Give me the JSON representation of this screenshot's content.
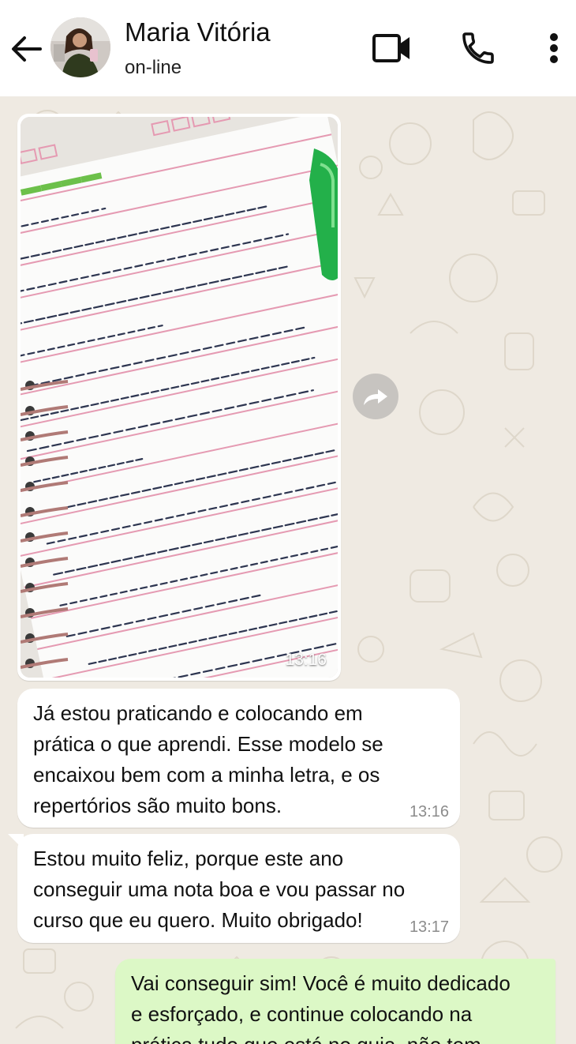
{
  "header": {
    "contact_name": "Maria Vitória",
    "contact_status": "on-line",
    "back_icon": "arrow-left-icon",
    "video_icon": "video-camera-icon",
    "call_icon": "phone-icon",
    "menu_icon": "more-vertical-icon"
  },
  "messages": [
    {
      "type": "image",
      "direction": "in",
      "time": "13:16",
      "image_description_icon": "notebook-photo"
    },
    {
      "type": "text",
      "direction": "in",
      "text": "Já estou praticando e colocando em\nprática o que aprendi. Esse modelo se\nencaixou bem com a minha letra, e os\nrepertórios são muito bons.",
      "time": "13:16"
    },
    {
      "type": "text",
      "direction": "in",
      "text": "Estou muito feliz, porque este ano\nconseguir uma nota boa e vou passar no\ncurso que eu quero. Muito obrigado!",
      "time": "13:17"
    },
    {
      "type": "text",
      "direction": "out",
      "text": "Vai conseguir sim! Você é muito dedicado\ne esforçado, e continue colocando na\nprática tudo que está no guia, não tem",
      "time": ""
    }
  ],
  "forward_icon": "forward-icon",
  "colors": {
    "chat_background": "#efeae2",
    "incoming_bubble": "#ffffff",
    "outgoing_bubble": "#dcf8c6",
    "timestamp": "#8c8c8c"
  }
}
